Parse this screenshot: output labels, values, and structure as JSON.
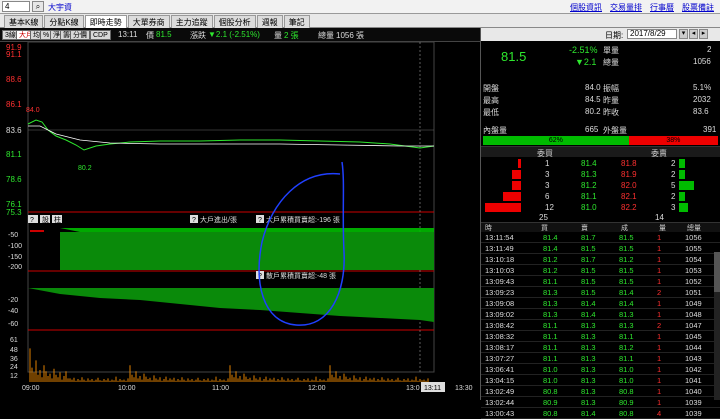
{
  "topbar": {
    "code": "4",
    "stock_name": "大宇資",
    "links": [
      "個股資訊",
      "交易量排",
      "行事曆",
      "股票備註"
    ]
  },
  "tabs": [
    "基本K線",
    "分點K線",
    "即時走勢",
    "大單券商",
    "主力追蹤",
    "個股分析",
    "週報",
    "筆記"
  ],
  "active_tab": 2,
  "toolbar": {
    "buttons": [
      "3線",
      "大戶",
      "均",
      "%",
      "淨",
      "籌",
      "分價",
      "CDP"
    ],
    "time": "13:11",
    "price_label": "價",
    "price": "81.5",
    "change_label": "漲跌",
    "change": "▼2.1 (-2.51%)",
    "volume_label": "量",
    "volume": "2 張",
    "total_label": "總量",
    "total": "1056 張"
  },
  "chart": {
    "price_labels": [
      {
        "text": "91.9",
        "color": "#ff3030"
      },
      {
        "text": "91.1",
        "color": "#ff3030"
      },
      {
        "text": "88.6",
        "color": "#ff3030"
      },
      {
        "text": "86.1",
        "color": "#ff3030"
      },
      {
        "text": "83.6",
        "color": "#dddddd"
      },
      {
        "text": "81.1",
        "color": "#2ee82e"
      },
      {
        "text": "78.6",
        "color": "#2ee82e"
      },
      {
        "text": "76.1",
        "color": "#2ee82e"
      },
      {
        "text": "75.3",
        "color": "#2ee82e"
      }
    ],
    "open_annot": "84.0",
    "low_annot": "80.2",
    "sub1_label": "大戶進出/張",
    "sub1_ind": "大戶累積買賣超:-196 張",
    "sub2_ind": "散戶累積買賣超:-48 張",
    "sub_buttons": [
      "?",
      "設",
      "柱"
    ],
    "sub1_axis": [
      "-50",
      "-100",
      "-150",
      "-200"
    ],
    "sub2_axis": [
      "-20",
      "-40",
      "-60"
    ],
    "vol_axis": [
      "61",
      "48",
      "36",
      "24",
      "12"
    ],
    "time_axis": [
      "09:00",
      "10:00",
      "11:00",
      "12:00",
      "13:0",
      "13:11",
      "13:30"
    ]
  },
  "quote": {
    "date_label": "日期:",
    "date": "2017/8/29",
    "price": "81.5",
    "pct": "-2.51%",
    "chg": "▼2.1",
    "single_label": "單量",
    "single": "2",
    "total_label": "總量",
    "total": "1056"
  },
  "stats": [
    {
      "l1": "開盤",
      "v1": "84.0",
      "c1": "up",
      "l2": "振幅",
      "v2": "5.1%"
    },
    {
      "l1": "最高",
      "v1": "84.5",
      "c1": "up",
      "l2": "昨量",
      "v2": "2032"
    },
    {
      "l1": "最低",
      "v1": "80.2",
      "c1": "dn",
      "l2": "昨收",
      "v2": "83.6"
    }
  ],
  "inout": {
    "in_label": "內盤量",
    "in": "665",
    "out_label": "外盤量",
    "out": "391"
  },
  "ratio": {
    "buy": "62%",
    "sell": "38%",
    "buy_fraction": 0.62
  },
  "orderbook": {
    "buy_head": "委買",
    "sell_head": "委賣",
    "rows": [
      {
        "bq": "1",
        "bp": "81.4",
        "sp": "81.8",
        "sq": "2"
      },
      {
        "bq": "3",
        "bp": "81.3",
        "sp": "81.9",
        "sq": "2"
      },
      {
        "bq": "3",
        "bp": "81.2",
        "sp": "82.0",
        "sq": "5"
      },
      {
        "bq": "6",
        "bp": "81.1",
        "sp": "82.1",
        "sq": "2"
      },
      {
        "bq": "12",
        "bp": "81.0",
        "sp": "82.2",
        "sq": "3"
      }
    ],
    "buy_total": "25",
    "sell_total": "14"
  },
  "ticks": {
    "headers": [
      "時",
      "買",
      "賣",
      "成",
      "量",
      "總量"
    ],
    "rows": [
      [
        "13:11:54",
        "81.4",
        "81.7",
        "81.5",
        "1",
        "1056"
      ],
      [
        "13:11:49",
        "81.4",
        "81.5",
        "81.5",
        "1",
        "1055"
      ],
      [
        "13:10:18",
        "81.2",
        "81.7",
        "81.2",
        "1",
        "1054"
      ],
      [
        "13:10:03",
        "81.2",
        "81.5",
        "81.5",
        "1",
        "1053"
      ],
      [
        "13:09:43",
        "81.1",
        "81.5",
        "81.5",
        "1",
        "1052"
      ],
      [
        "13:09:23",
        "81.3",
        "81.5",
        "81.4",
        "2",
        "1051"
      ],
      [
        "13:09:08",
        "81.3",
        "81.4",
        "81.4",
        "1",
        "1049"
      ],
      [
        "13:09:02",
        "81.3",
        "81.4",
        "81.3",
        "1",
        "1048"
      ],
      [
        "13:08:42",
        "81.1",
        "81.3",
        "81.3",
        "2",
        "1047"
      ],
      [
        "13:08:32",
        "81.1",
        "81.3",
        "81.1",
        "1",
        "1045"
      ],
      [
        "13:08:17",
        "81.1",
        "81.3",
        "81.2",
        "1",
        "1044"
      ],
      [
        "13:07:27",
        "81.1",
        "81.3",
        "81.1",
        "1",
        "1043"
      ],
      [
        "13:06:41",
        "81.0",
        "81.3",
        "81.0",
        "1",
        "1042"
      ],
      [
        "13:04:15",
        "81.0",
        "81.3",
        "81.0",
        "1",
        "1041"
      ],
      [
        "13:02:49",
        "80.8",
        "81.3",
        "80.8",
        "1",
        "1040"
      ],
      [
        "13:02:44",
        "80.9",
        "81.3",
        "80.9",
        "1",
        "1039"
      ],
      [
        "13:00:43",
        "80.8",
        "81.4",
        "80.8",
        "4",
        "1039"
      ]
    ]
  }
}
